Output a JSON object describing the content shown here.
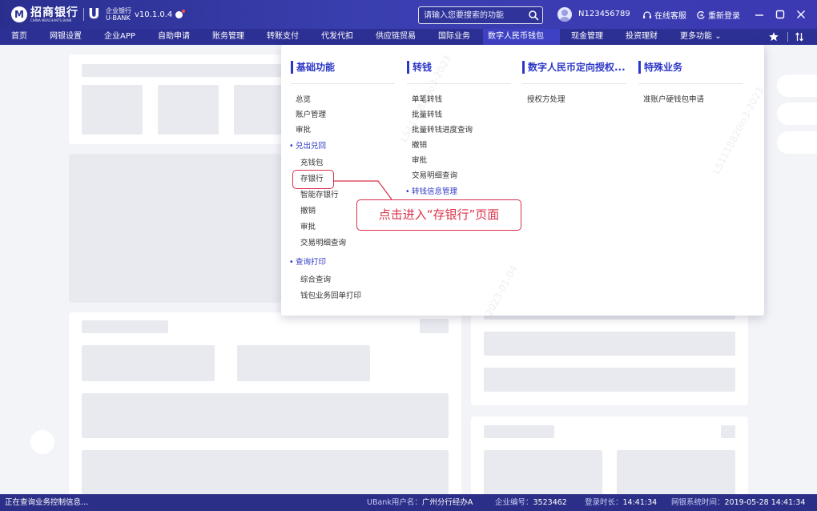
{
  "app": {
    "logo_mark": "M",
    "brand_name": "招商银行",
    "brand_sub": "CHINA MERCHANTS BANK",
    "product_top": "企业银行",
    "product_bottom": "U-BANK",
    "version": "v10.1.0.4"
  },
  "header": {
    "search_placeholder": "请输入您要搜索的功能",
    "user_id": "N123456789",
    "online_service": "在线客服",
    "relogin": "重新登录"
  },
  "nav": {
    "items": [
      "首页",
      "网银设置",
      "企业APP",
      "自助申请",
      "账务管理",
      "转账支付",
      "代发代扣",
      "供应链贸易",
      "国际业务",
      "数字人民币钱包",
      "现金管理",
      "投资理财",
      "更多功能"
    ],
    "active_index": 9
  },
  "menu": {
    "columns": [
      {
        "title": "基础功能",
        "items": [
          {
            "label": "总览",
            "group": false
          },
          {
            "label": "账户管理",
            "group": false
          },
          {
            "label": "审批",
            "group": false
          },
          {
            "label": "兑出兑回",
            "group": true
          },
          {
            "label": "充钱包",
            "group": false
          },
          {
            "label": "存银行",
            "group": false
          },
          {
            "label": "智能存银行",
            "group": false
          },
          {
            "label": "撤销",
            "group": false
          },
          {
            "label": "审批",
            "group": false
          },
          {
            "label": "交易明细查询",
            "group": false
          },
          {
            "label": "查询打印",
            "group": true
          },
          {
            "label": "综合查询",
            "group": false
          },
          {
            "label": "钱包业务回单打印",
            "group": false
          }
        ]
      },
      {
        "title": "转钱",
        "items": [
          {
            "label": "单笔转钱",
            "group": false
          },
          {
            "label": "批量转钱",
            "group": false
          },
          {
            "label": "批量转钱进度查询",
            "group": false
          },
          {
            "label": "撤销",
            "group": false
          },
          {
            "label": "审批",
            "group": false
          },
          {
            "label": "交易明细查询",
            "group": false
          },
          {
            "label": "转钱信息管理",
            "group": true
          }
        ]
      },
      {
        "title": "数字人民币定向授权...",
        "items": [
          {
            "label": "授权方处理",
            "group": false
          }
        ]
      },
      {
        "title": "特殊业务",
        "items": [
          {
            "label": "准账户硬钱包申请",
            "group": false
          }
        ]
      }
    ],
    "watermarks": [
      "LS1118820lo3-2023",
      "LS1118820lo3-2023",
      "2023-01-04"
    ]
  },
  "annotation": {
    "callout_text": "点击进入“存银行”页面",
    "highlight_color": "#d8314a"
  },
  "status": {
    "left": "正在查询业务控制信息…",
    "ubank_user_label": "UBank用户名：",
    "ubank_user": "广州分行经办A",
    "company_no_label": "企业编号：",
    "company_no": "3523462",
    "login_duration_label": "登录时长：",
    "login_duration": "14:41:34",
    "system_time_label": "网银系统时间：",
    "system_time": "2019-05-28  14:41:34"
  },
  "colors": {
    "brand": "#2c2f93",
    "accent": "#2c37c7",
    "highlight": "#d8314a"
  }
}
